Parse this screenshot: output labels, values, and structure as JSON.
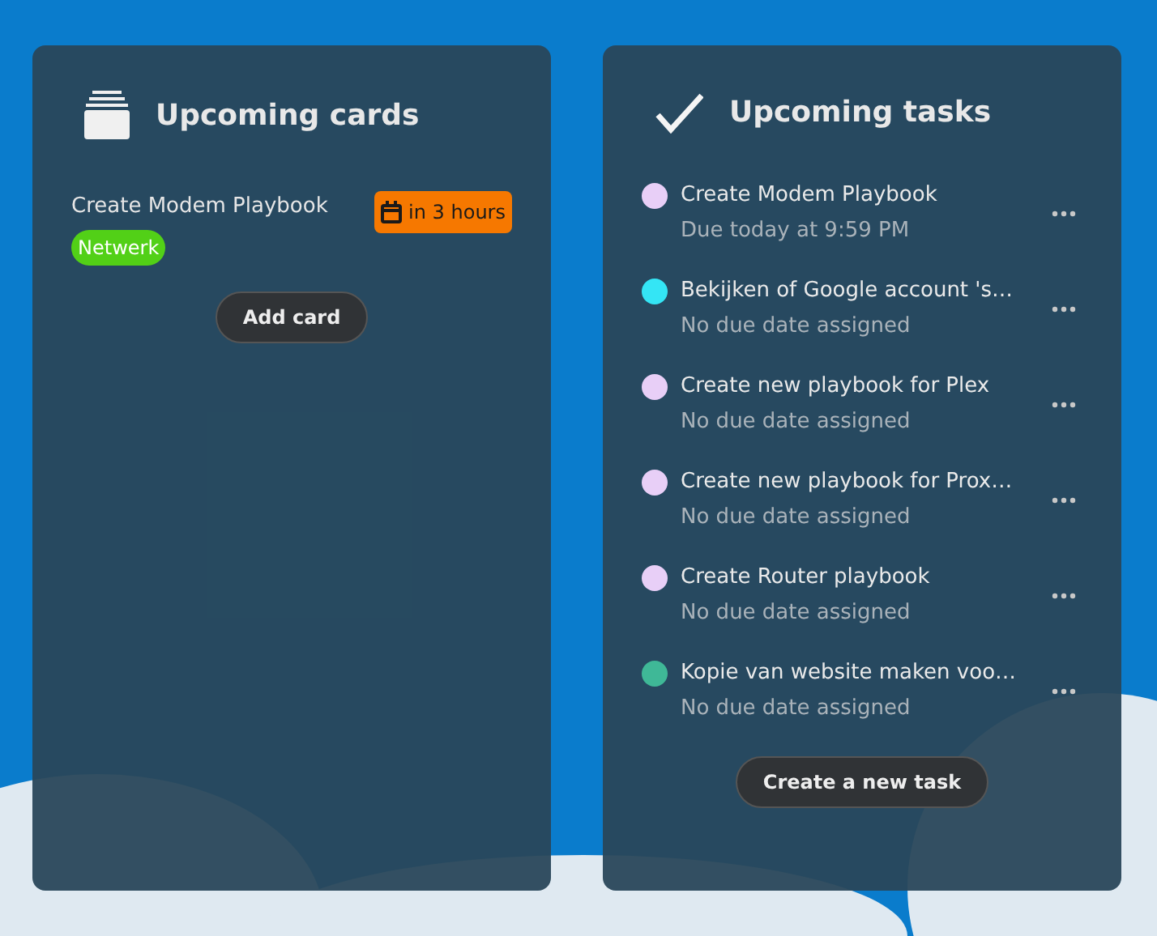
{
  "cards_panel": {
    "title": "Upcoming cards",
    "cards": [
      {
        "title": "Create Modem Playbook",
        "due": "in 3 hours",
        "labels": [
          {
            "text": "Netwerk",
            "color": "#52d017"
          }
        ]
      }
    ],
    "button": "Add card"
  },
  "tasks_panel": {
    "title": "Upcoming tasks",
    "tasks": [
      {
        "title": "Create Modem Playbook",
        "due": "Due today at 9:59 PM",
        "color": "#e8cff7"
      },
      {
        "title": "Bekijken of Google account 's…",
        "due": "No due date assigned",
        "color": "#34e5f5"
      },
      {
        "title": "Create new playbook for Plex",
        "due": "No due date assigned",
        "color": "#e8cff7"
      },
      {
        "title": "Create new playbook for Prox…",
        "due": "No due date assigned",
        "color": "#e8cff7"
      },
      {
        "title": "Create Router playbook",
        "due": "No due date assigned",
        "color": "#e8cff7"
      },
      {
        "title": "Kopie van website maken voo…",
        "due": "No due date assigned",
        "color": "#3fb897"
      }
    ],
    "button": "Create a new task"
  }
}
